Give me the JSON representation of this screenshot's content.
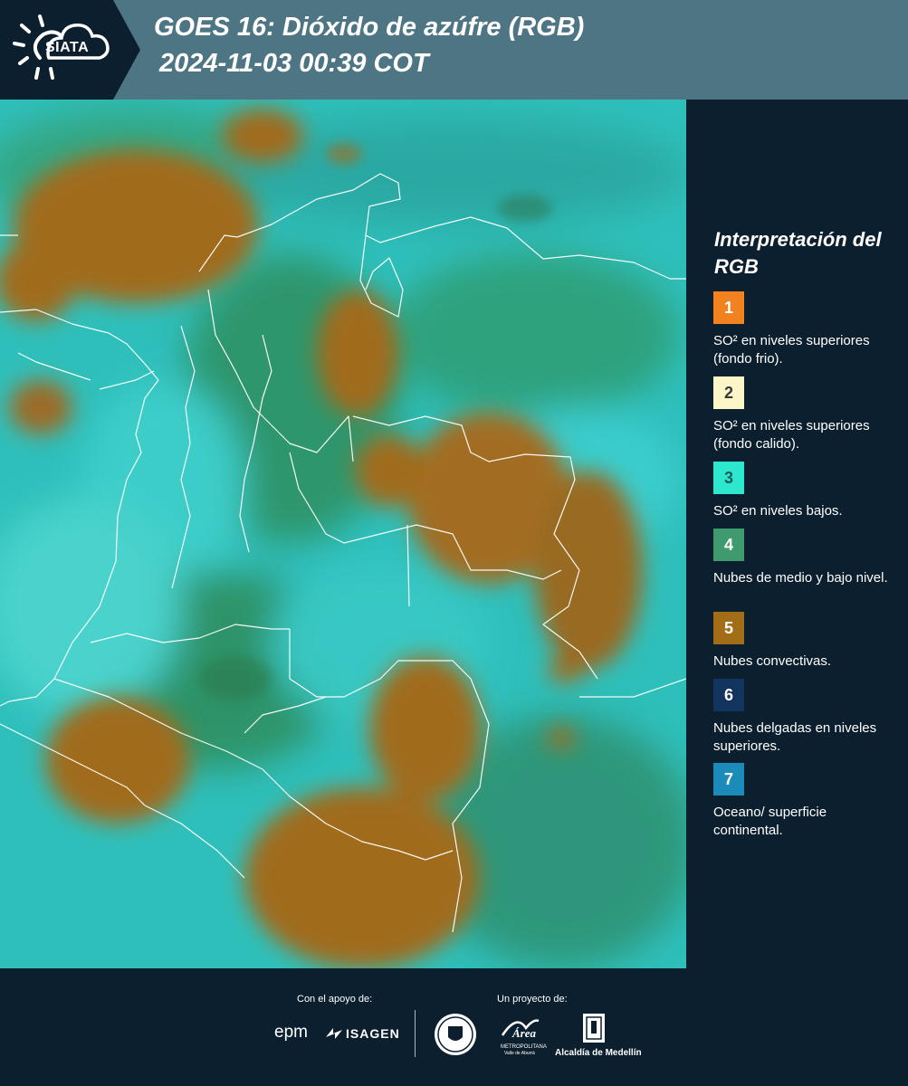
{
  "header": {
    "logo_text": "SIATA",
    "title": "GOES 16: Dióxido de azúfre (RGB)",
    "subtitle": "2024-11-03 00:39 COT"
  },
  "legend": {
    "title": "Interpretación del RGB",
    "items": [
      {
        "number": "1",
        "color": "#f2821f",
        "num_color": "#ffffff",
        "text": "SO² en niveles superiores (fondo frio)."
      },
      {
        "number": "2",
        "color": "#fbf5c8",
        "num_color": "#3a3a3a",
        "text": "SO² en niveles superiores (fondo calido)."
      },
      {
        "number": "3",
        "color": "#2de8cf",
        "num_color": "#1e5b5e",
        "text": "SO² en niveles bajos."
      },
      {
        "number": "4",
        "color": "#3f9a6e",
        "num_color": "#ffffff",
        "text": "Nubes de medio y bajo nivel."
      },
      {
        "number": "5",
        "color": "#a26d17",
        "num_color": "#ffffff",
        "text": "Nubes convectivas."
      },
      {
        "number": "6",
        "color": "#12355f",
        "num_color": "#ffffff",
        "text": "Nubes delgadas en niveles superiores."
      },
      {
        "number": "7",
        "color": "#1b8cba",
        "num_color": "#ffffff",
        "text": "Oceano/ superficie continental."
      }
    ]
  },
  "footer": {
    "support_label": "Con el apoyo de:",
    "project_label": "Un proyecto de:",
    "sponsor_1": "epm",
    "sponsor_2": "ISAGEN",
    "partner_1": "Área",
    "partner_1_sub": "METROPOLITANA",
    "partner_1_sub2": "Valle de Aburrá",
    "partner_2": "Alcaldía de Medellín"
  },
  "colors": {
    "header_bg": "#4e7584",
    "page_bg": "#0c1f2e",
    "cloud_brown": "#a06c1f",
    "cyan": "#2ed9d6",
    "green": "#2f8f5e"
  }
}
